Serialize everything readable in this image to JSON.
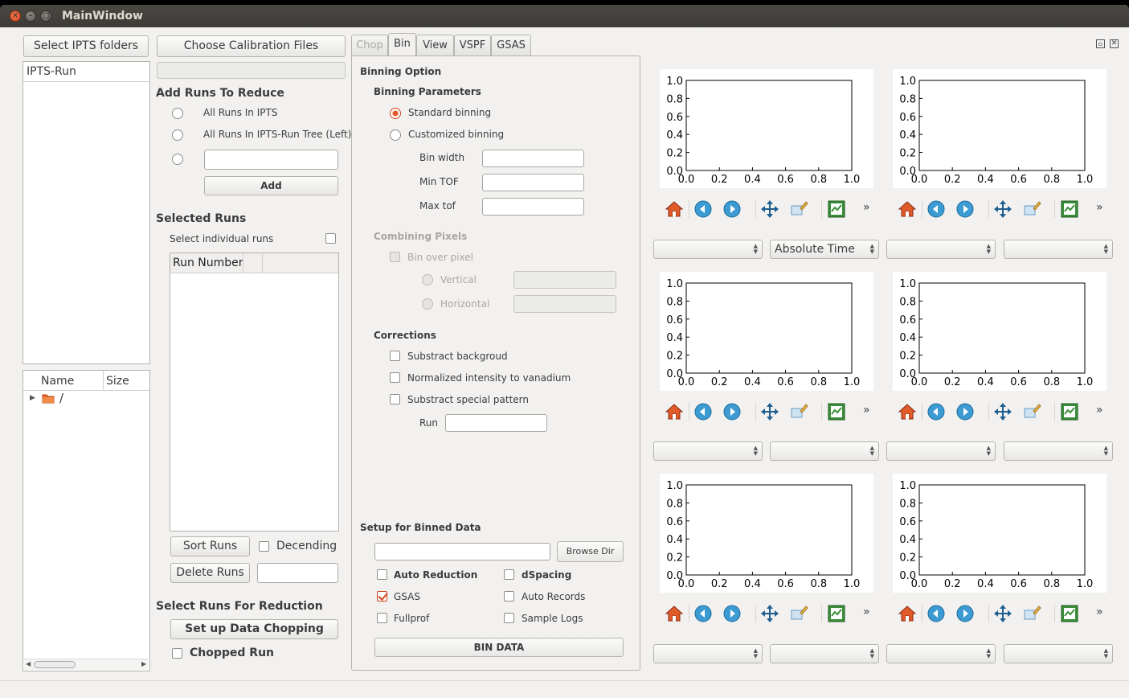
{
  "window": {
    "title": "MainWindow"
  },
  "left": {
    "select_ipts": "Select IPTS folders",
    "ipts_header": "IPTS-Run",
    "fs_name": "Name",
    "fs_size": "Size",
    "fs_root": "/"
  },
  "middle": {
    "choose_calib": "Choose Calibration Files",
    "add_runs_title": "Add Runs To Reduce",
    "opt_all_ipts": "All Runs In IPTS",
    "opt_all_tree": "All Runs In IPTS-Run Tree (Left)",
    "add_btn": "Add",
    "selected_runs": "Selected Runs",
    "select_individual": "Select individual runs",
    "run_number_col": "Run Number",
    "sort_runs": "Sort Runs",
    "decending": "Decending",
    "delete_runs": "Delete Runs",
    "select_for_reduction": "Select Runs For Reduction",
    "setup_chopping": "Set up Data Chopping",
    "chopped_run": "Chopped Run"
  },
  "tabs": [
    {
      "label": "Chop",
      "state": "disabled"
    },
    {
      "label": "Bin",
      "state": "active"
    },
    {
      "label": "View",
      "state": "normal"
    },
    {
      "label": "VSPF",
      "state": "normal"
    },
    {
      "label": "GSAS",
      "state": "normal"
    }
  ],
  "bin": {
    "binning_option": "Binning Option",
    "binning_params": "Binning Parameters",
    "standard": "Standard binning",
    "customized": "Customized binning",
    "bin_width": "Bin width",
    "min_tof": "Min TOF",
    "max_tof": "Max tof",
    "combining": "Combining Pixels",
    "bin_over_pixel": "Bin over pixel",
    "vertical": "Vertical",
    "horizontal": "Horizontal",
    "corrections": "Corrections",
    "sub_bg": "Substract backgroud",
    "norm_van": "Normalized intensity to vanadium",
    "sub_special": "Substract special pattern",
    "run": "Run",
    "setup_binned": "Setup for Binned Data",
    "browse_dir": "Browse Dir",
    "auto_reduction": "Auto Reduction",
    "dspacing": "dSpacing",
    "gsas": "GSAS",
    "auto_records": "Auto Records",
    "fullprof": "Fullprof",
    "sample_logs": "Sample Logs",
    "bin_data": "BIN DATA"
  },
  "plots": {
    "y_ticks": [
      "1.0",
      "0.8",
      "0.6",
      "0.4",
      "0.2",
      "0.0"
    ],
    "x_ticks": [
      "0.0",
      "0.2",
      "0.4",
      "0.6",
      "0.8",
      "1.0"
    ],
    "more": "»",
    "combo_row1": [
      "",
      "Absolute Time",
      "",
      ""
    ],
    "combo_row2": [
      "",
      "",
      "",
      ""
    ],
    "combo_row3": [
      "",
      "",
      "",
      ""
    ]
  },
  "icons": [
    "home-icon",
    "back-icon",
    "forward-icon",
    "pan-icon",
    "zoom-icon",
    "save-figure-icon"
  ]
}
